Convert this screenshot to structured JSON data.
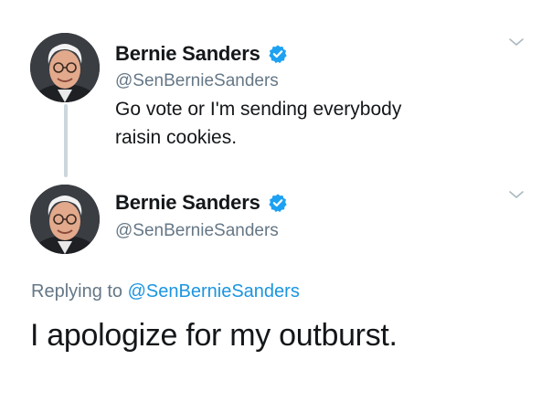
{
  "tweets": [
    {
      "name": "Bernie Sanders",
      "handle": "@SenBernieSanders",
      "text_line1": "Go vote or I'm sending everybody",
      "text_line2": "raisin cookies.",
      "verified_icon": "verified-badge-icon",
      "menu_icon": "chevron-down-icon"
    },
    {
      "name": "Bernie Sanders",
      "handle": "@SenBernieSanders",
      "replying_prefix": "Replying to ",
      "replying_mention": "@SenBernieSanders",
      "text": "I apologize for my outburst.",
      "verified_icon": "verified-badge-icon",
      "menu_icon": "chevron-down-icon"
    }
  ],
  "colors": {
    "text": "#14171a",
    "secondary": "#657786",
    "link": "#1b95e0",
    "verified": "#1da1f2",
    "thread_line": "#ccd6dd"
  }
}
